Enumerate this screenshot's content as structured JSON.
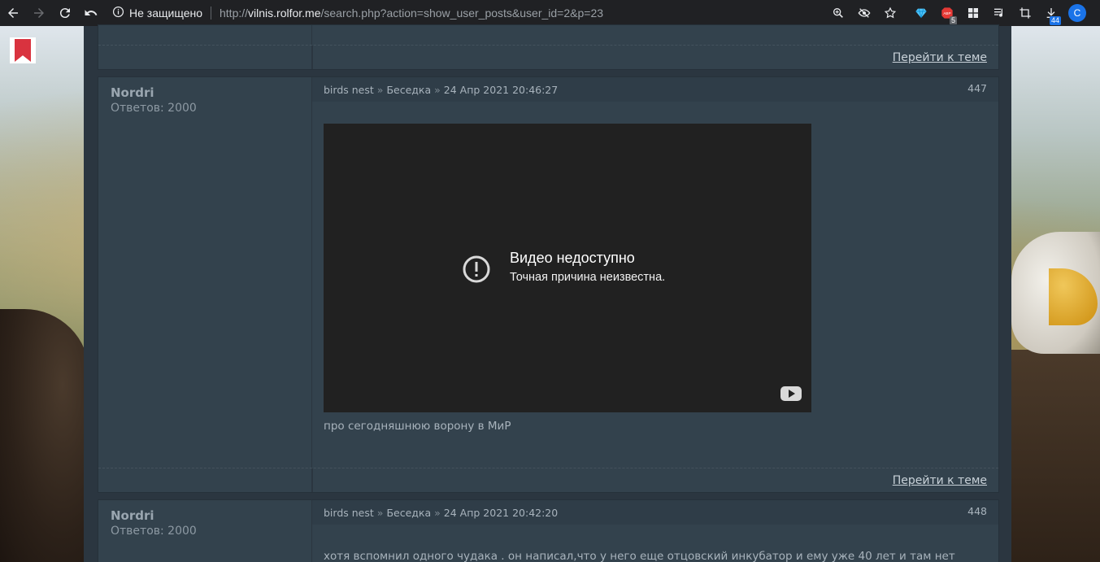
{
  "browser": {
    "security_label": "Не защищено",
    "url_scheme": "http://",
    "url_host": "vilnis.rolfor.me",
    "url_path": "/search.php?action=show_user_posts&user_id=2&p=23",
    "abp_count": "5",
    "downloads_count": "44",
    "profile_initial": "C"
  },
  "top_post_footer": {
    "goto_label": "Перейти к теме"
  },
  "posts": [
    {
      "author": "Nordri",
      "replies_label": "Ответов: 2000",
      "forum": "birds nest",
      "topic": "Беседка",
      "date": "24 Апр 2021 20:46:27",
      "number": "447",
      "video_title": "Видео недоступно",
      "video_subtitle": "Точная причина неизвестна.",
      "text": "про сегодняшнюю ворону в МиР",
      "goto_label": "Перейти к теме"
    },
    {
      "author": "Nordri",
      "replies_label": "Ответов: 2000",
      "forum": "birds nest",
      "topic": "Беседка",
      "date": "24 Апр 2021 20:42:20",
      "number": "448",
      "text": "хотя вспомнил одного чудака . он  написал,что у него еще отцовский инкубатор и ему уже 40 лет и там нет"
    }
  ],
  "crumb_separator": "»"
}
